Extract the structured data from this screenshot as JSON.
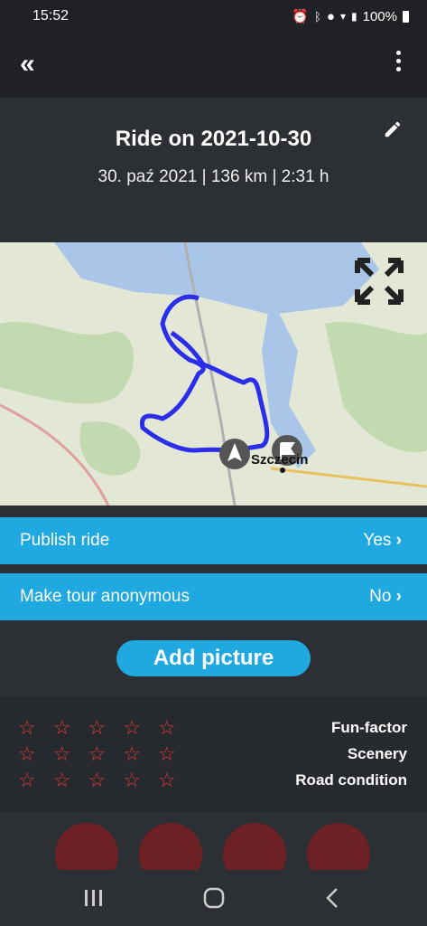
{
  "status": {
    "time": "15:52",
    "battery": "100%"
  },
  "appbar": {
    "back_icon": "double-chevron-left-icon",
    "menu_icon": "more-vertical-icon"
  },
  "ride": {
    "title": "Ride on 2021-10-30",
    "summary": "30. paź 2021 | 136 km | 2:31 h"
  },
  "map": {
    "place_label": "Szczecin",
    "route_color": "#2b2ee8"
  },
  "settings": {
    "publish": {
      "label": "Publish ride",
      "value": "Yes"
    },
    "anonymous": {
      "label": "Make tour anonymous",
      "value": "No"
    }
  },
  "add_picture": "Add picture",
  "ratings": {
    "fun": {
      "label": "Fun-factor",
      "stars": 0
    },
    "scenery": {
      "label": "Scenery",
      "stars": 0
    },
    "road": {
      "label": "Road condition",
      "stars": 0
    }
  },
  "categories": [
    "forest-icon",
    "mountains-icon",
    "cactus-icon",
    "lighthouse-icon"
  ],
  "colors": {
    "accent": "#20a8e0",
    "background": "#2c2f33",
    "star": "#e0383a"
  }
}
